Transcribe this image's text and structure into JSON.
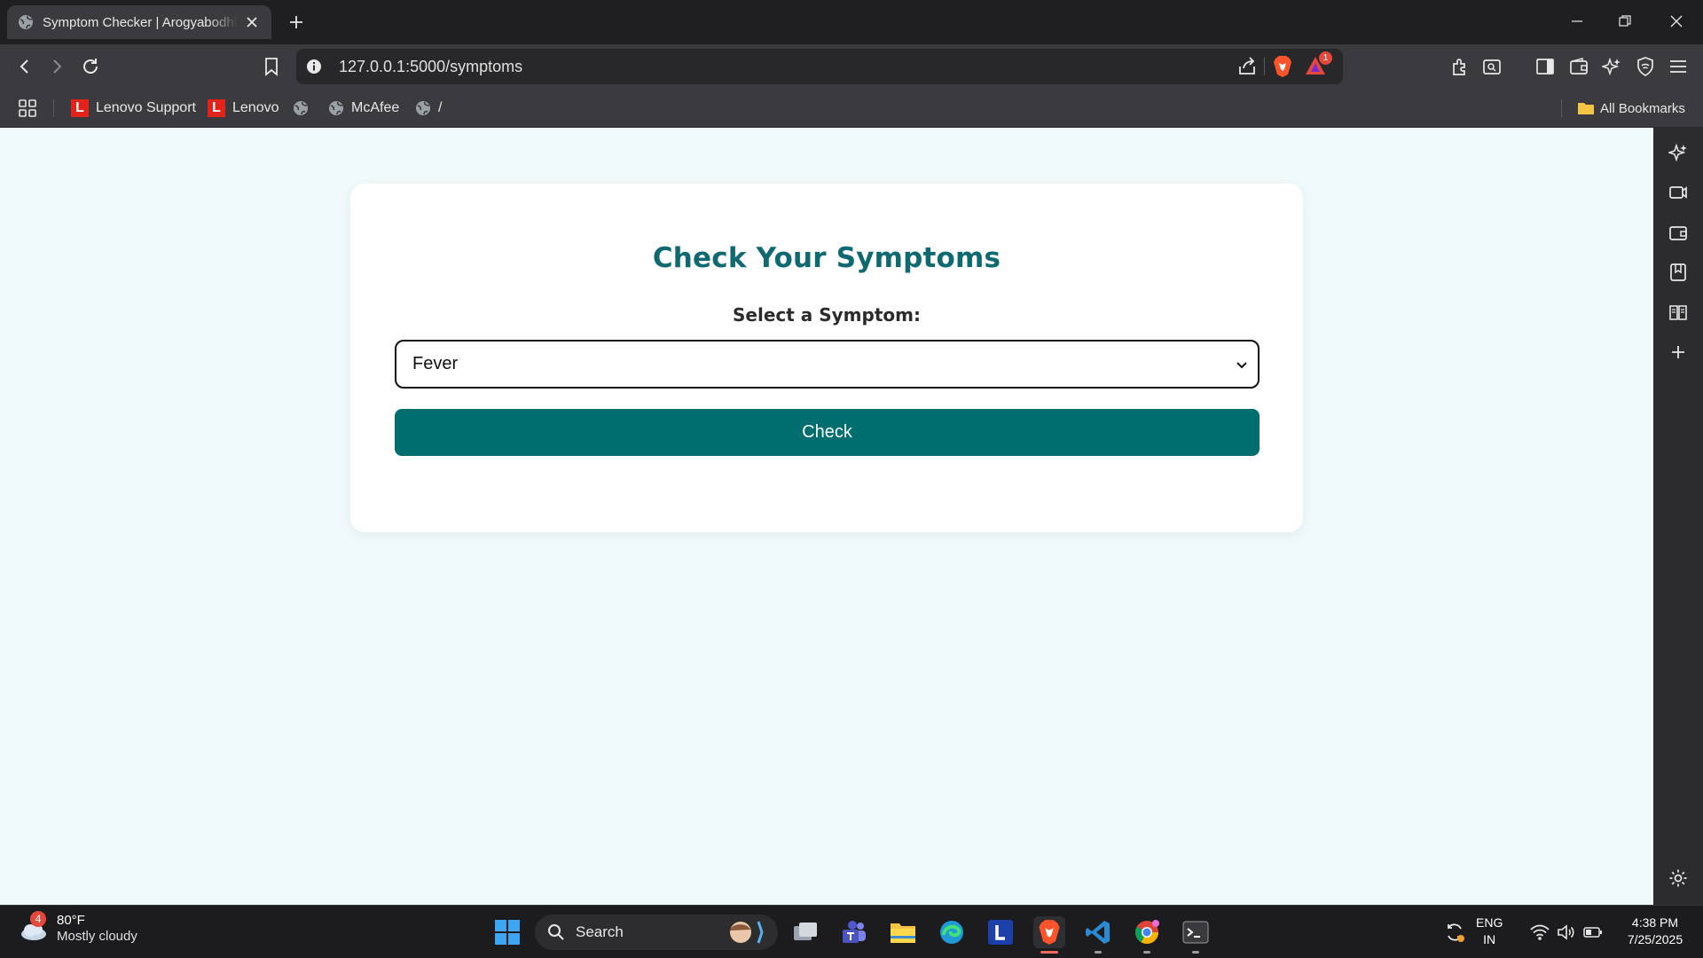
{
  "browser": {
    "tab": {
      "title": "Symptom Checker | Arogyabodhi"
    },
    "url": "127.0.0.1:5000/symptoms",
    "rewards_badge": "1",
    "bookmarks": [
      {
        "label": "Lenovo Support",
        "icon": "lenovo-icon"
      },
      {
        "label": "Lenovo",
        "icon": "lenovo-icon"
      },
      {
        "label": "",
        "icon": "globe-icon"
      },
      {
        "label": "McAfee",
        "icon": "globe-icon"
      },
      {
        "label": "/",
        "icon": "globe-icon"
      }
    ],
    "all_bookmarks_label": "All Bookmarks"
  },
  "page": {
    "title": "Check Your Symptoms",
    "select_label": "Select a Symptom:",
    "selected_symptom": "Fever",
    "check_button": "Check"
  },
  "taskbar": {
    "weather_temp": "80°F",
    "weather_desc": "Mostly cloudy",
    "weather_badge": "4",
    "search_label": "Search",
    "lang_top": "ENG",
    "lang_bottom": "IN",
    "time": "4:38 PM",
    "date": "7/25/2025"
  },
  "colors": {
    "accent": "#006d6f",
    "title": "#0e6a70",
    "page_bg": "#f1fafb"
  }
}
